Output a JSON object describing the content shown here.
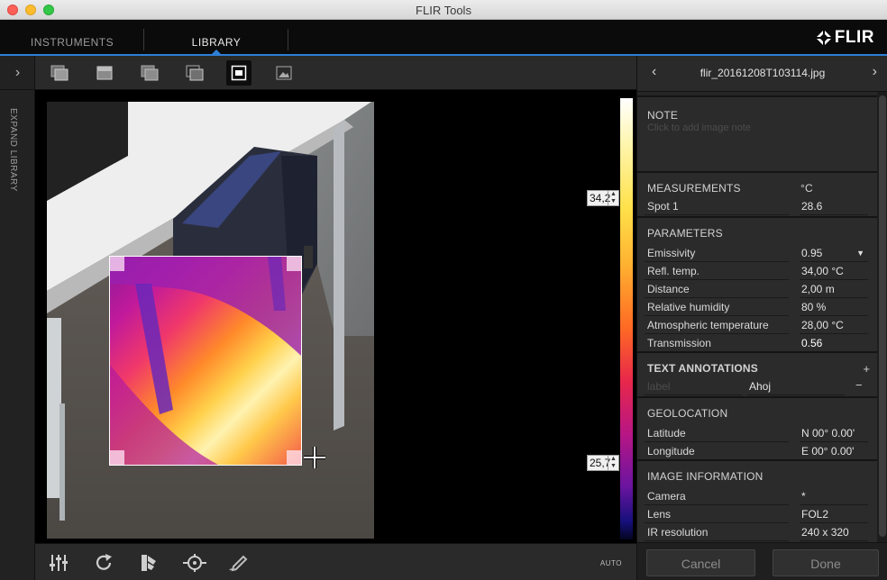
{
  "window": {
    "title": "FLIR Tools"
  },
  "nav": {
    "tabs": [
      "INSTRUMENTS",
      "LIBRARY"
    ],
    "active_tab": "LIBRARY",
    "logo_text": "FLIR"
  },
  "sidebar": {
    "expand_label": "EXPAND LIBRARY"
  },
  "toolbar": {
    "icons": [
      "ir-mode-icon",
      "visual-mode-icon",
      "msx-mode-icon",
      "fusion-blend-icon",
      "picture-in-picture-icon",
      "photo-icon"
    ],
    "active": "picture-in-picture-icon"
  },
  "image": {
    "scale_max": "34,2",
    "scale_min": "25,7"
  },
  "bottom_toolbar": {
    "icons": [
      "sliders-icon",
      "rotate-icon",
      "palette-icon",
      "spot-measure-icon",
      "edit-icon"
    ],
    "auto_label": "AUTO"
  },
  "panel": {
    "filename": "flir_20161208T103114.jpg",
    "note": {
      "title": "NOTE",
      "placeholder": "Click to add image note"
    },
    "measurements": {
      "title": "MEASUREMENTS",
      "unit": "°C",
      "rows": [
        {
          "label": "Spot 1",
          "value": "28.6"
        }
      ]
    },
    "parameters": {
      "title": "PARAMETERS",
      "rows": [
        {
          "label": "Emissivity",
          "value": "0.95"
        },
        {
          "label": "Refl. temp.",
          "value": "34,00 °C"
        },
        {
          "label": "Distance",
          "value": "2,00 m"
        },
        {
          "label": "Relative humidity",
          "value": "80 %"
        },
        {
          "label": "Atmospheric temperature",
          "value": "28,00 °C"
        },
        {
          "label": "Transmission",
          "value": "0.56"
        }
      ]
    },
    "text_annotations": {
      "title": "TEXT ANNOTATIONS",
      "add": "+",
      "remove": "−",
      "rows": [
        {
          "label": "label",
          "value": "Ahoj"
        }
      ]
    },
    "geolocation": {
      "title": "GEOLOCATION",
      "rows": [
        {
          "label": "Latitude",
          "value": "N 00° 0.00'"
        },
        {
          "label": "Longitude",
          "value": "E 00° 0.00'"
        }
      ]
    },
    "image_information": {
      "title": "IMAGE INFORMATION",
      "rows": [
        {
          "label": "Camera",
          "value": "*"
        },
        {
          "label": "Lens",
          "value": "FOL2"
        },
        {
          "label": "IR resolution",
          "value": "240 x 320"
        }
      ]
    },
    "buttons": {
      "cancel": "Cancel",
      "done": "Done"
    }
  }
}
